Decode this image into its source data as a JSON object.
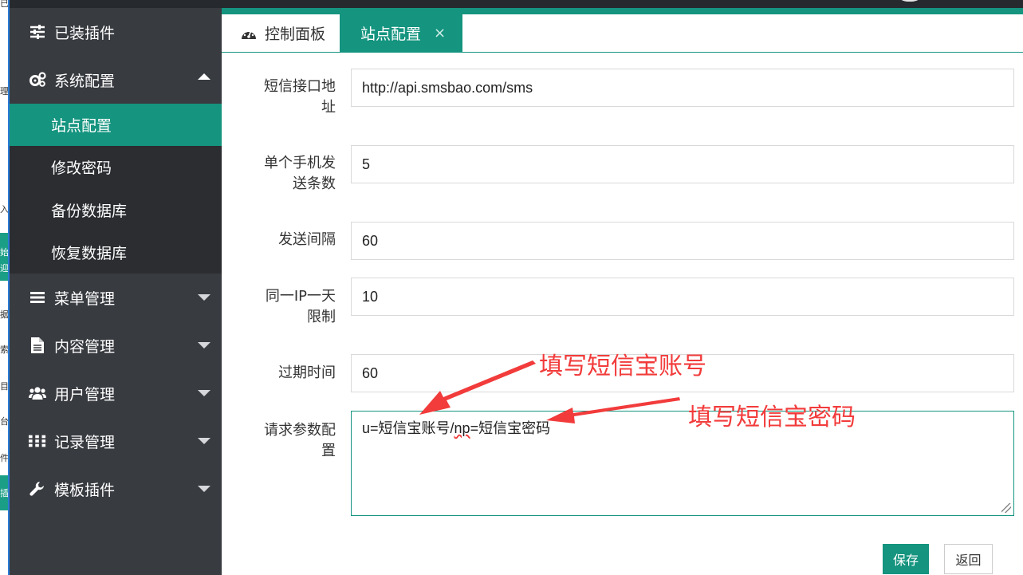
{
  "left_strip": {
    "fragments": [
      "已",
      "理",
      "入",
      "始",
      "迎",
      "据",
      "索",
      "目",
      "台",
      "件",
      "插"
    ]
  },
  "sidebar": {
    "items": [
      {
        "label": "已装插件",
        "icon": "sliders-icon"
      },
      {
        "label": "系统配置",
        "icon": "cogs-icon",
        "expanded": true
      },
      {
        "label": "菜单管理",
        "icon": "menu-bars-icon"
      },
      {
        "label": "内容管理",
        "icon": "file-icon"
      },
      {
        "label": "用户管理",
        "icon": "users-icon"
      },
      {
        "label": "记录管理",
        "icon": "grid-dots-icon"
      },
      {
        "label": "模板插件",
        "icon": "wrench-icon"
      }
    ],
    "sub_items": [
      {
        "label": "站点配置",
        "active": true
      },
      {
        "label": "修改密码"
      },
      {
        "label": "备份数据库"
      },
      {
        "label": "恢复数据库"
      }
    ]
  },
  "tabs": [
    {
      "label": "控制面板",
      "icon": "dashboard-icon"
    },
    {
      "label": "站点配置",
      "active": true,
      "close": "×"
    }
  ],
  "form": {
    "fields": [
      {
        "label_line1": "短信接口地",
        "label_line2": "址",
        "value": "http://api.smsbao.com/sms"
      },
      {
        "label_line1": "单个手机发",
        "label_line2": "送条数",
        "value": "5"
      },
      {
        "label_line1": "发送间隔",
        "label_line2": "",
        "value": "60"
      },
      {
        "label_line1": "同一IP一天",
        "label_line2": "限制",
        "value": "10"
      },
      {
        "label_line1": "过期时间",
        "label_line2": "",
        "value": "60"
      }
    ],
    "params": {
      "label_line1": "请求参数配",
      "label_line2": "置",
      "value_part1": "u=短信宝账号/",
      "value_part2": "np",
      "value_part3": "=短信宝密码"
    },
    "save_label": "保存",
    "back_label": "返回"
  },
  "annotations": {
    "account": "填写短信宝账号",
    "password": "填写短信宝密码"
  },
  "colors": {
    "accent": "#15947f",
    "sidebar_bg": "#383b40",
    "submenu_bg": "#2b2d31",
    "annotation": "#f23b3b"
  }
}
